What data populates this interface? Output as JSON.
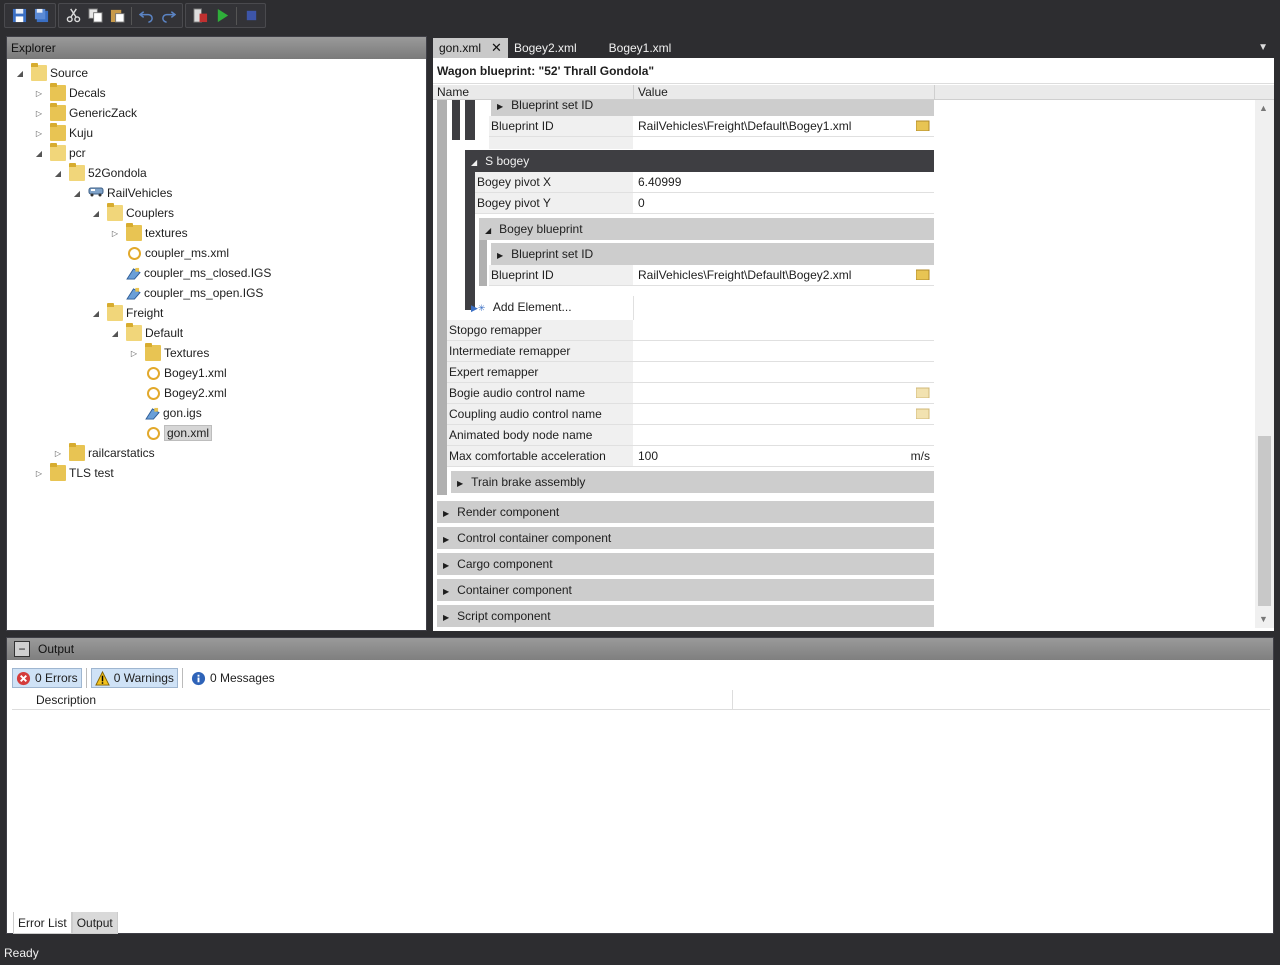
{
  "toolbar": {
    "buttons": [
      "save-icon",
      "save-all-icon",
      "cut-icon",
      "copy-icon",
      "paste-icon",
      "undo-icon",
      "redo-icon",
      "export-icon",
      "run-icon",
      "stop-icon"
    ]
  },
  "explorer": {
    "title": "Explorer",
    "items": [
      {
        "label": "Source",
        "icon": "folder-open"
      },
      {
        "label": "Decals",
        "icon": "folder"
      },
      {
        "label": "GenericZack",
        "icon": "folder"
      },
      {
        "label": "Kuju",
        "icon": "folder"
      },
      {
        "label": "pcr",
        "icon": "folder-open"
      },
      {
        "label": "52Gondola",
        "icon": "folder-open"
      },
      {
        "label": "RailVehicles",
        "icon": "railvehicle"
      },
      {
        "label": "Couplers",
        "icon": "folder-open"
      },
      {
        "label": "textures",
        "icon": "folder"
      },
      {
        "label": "coupler_ms.xml",
        "icon": "xml"
      },
      {
        "label": "coupler_ms_closed.IGS",
        "icon": "igs"
      },
      {
        "label": "coupler_ms_open.IGS",
        "icon": "igs"
      },
      {
        "label": "Freight",
        "icon": "folder-open"
      },
      {
        "label": "Default",
        "icon": "folder-open"
      },
      {
        "label": "Textures",
        "icon": "folder"
      },
      {
        "label": "Bogey1.xml",
        "icon": "xml"
      },
      {
        "label": "Bogey2.xml",
        "icon": "xml"
      },
      {
        "label": "gon.igs",
        "icon": "igs"
      },
      {
        "label": "gon.xml",
        "icon": "xml"
      },
      {
        "label": "railcarstatics",
        "icon": "folder"
      },
      {
        "label": "TLS test",
        "icon": "folder"
      }
    ]
  },
  "tabs": [
    {
      "label": "gon.xml",
      "active": true
    },
    {
      "label": "Bogey2.xml"
    },
    {
      "label": "Bogey1.xml"
    }
  ],
  "editor": {
    "title": "Wagon blueprint: \"52' Thrall Gondola\"",
    "col_name": "Name",
    "col_value": "Value",
    "rows": {
      "bp_set_id_1": "Blueprint set ID",
      "bp_id_1_name": "Blueprint ID",
      "bp_id_1_value": "RailVehicles\\Freight\\Default\\Bogey1.xml",
      "s_bogey": "S bogey",
      "pivot_x_name": "Bogey pivot X",
      "pivot_x_value": "6.40999",
      "pivot_y_name": "Bogey pivot Y",
      "pivot_y_value": "0",
      "bogey_blueprint": "Bogey blueprint",
      "bp_set_id_2": "Blueprint set ID",
      "bp_id_2_name": "Blueprint ID",
      "bp_id_2_value": "RailVehicles\\Freight\\Default\\Bogey2.xml",
      "add_element": "Add Element...",
      "stopgo": "Stopgo remapper",
      "intermediate": "Intermediate remapper",
      "expert": "Expert remapper",
      "bogie_audio": "Bogie audio control name",
      "coupling_audio": "Coupling audio control name",
      "animated_body": "Animated body node name",
      "max_accel_name": "Max comfortable acceleration",
      "max_accel_value": "100",
      "max_accel_unit": "m/s",
      "train_brake": "Train brake assembly",
      "render": "Render component",
      "control_container": "Control container component",
      "cargo": "Cargo component",
      "container": "Container component",
      "script": "Script component"
    }
  },
  "output": {
    "title": "Output",
    "errors": "0 Errors",
    "warnings": "0 Warnings",
    "messages": "0 Messages",
    "col_description": "Description",
    "tab_error_list": "Error List",
    "tab_output": "Output"
  },
  "status": "Ready"
}
